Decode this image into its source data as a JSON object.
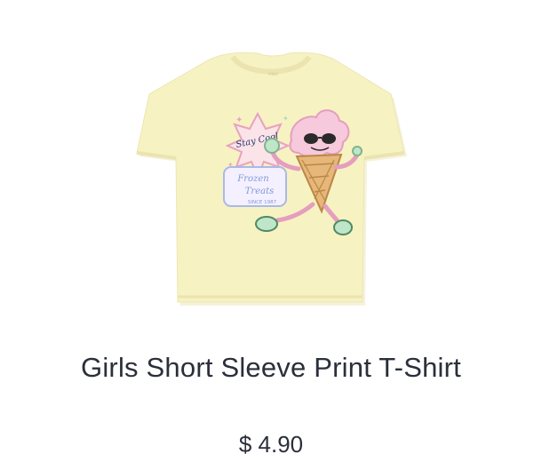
{
  "product": {
    "title": "Girls Short Sleeve Print T-Shirt",
    "price": "$ 4.90",
    "image_icon": "tshirt-image",
    "print_text_top": "Stay Cool",
    "print_text_bottom_1": "Frozen",
    "print_text_bottom_2": "Treats",
    "print_text_bottom_3": "SINCE 1987"
  },
  "colors": {
    "shirt": "#f7f2c2",
    "text": "#2b2f3a"
  }
}
